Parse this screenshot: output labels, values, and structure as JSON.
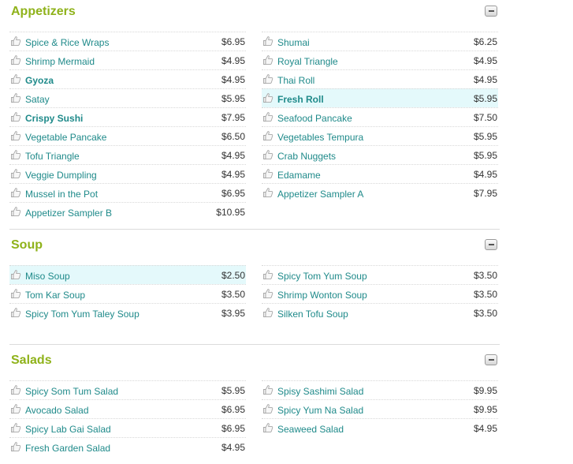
{
  "sections": [
    {
      "title": "Appetizers",
      "left": [
        {
          "name": "Spice & Rice Wraps",
          "price": "$6.95",
          "bold": false,
          "hl": false
        },
        {
          "name": "Shrimp Mermaid",
          "price": "$4.95",
          "bold": false,
          "hl": false
        },
        {
          "name": "Gyoza",
          "price": "$4.95",
          "bold": true,
          "hl": false
        },
        {
          "name": "Satay",
          "price": "$5.95",
          "bold": false,
          "hl": false
        },
        {
          "name": "Crispy Sushi",
          "price": "$7.95",
          "bold": true,
          "hl": false
        },
        {
          "name": "Vegetable Pancake",
          "price": "$6.50",
          "bold": false,
          "hl": false
        },
        {
          "name": "Tofu Triangle",
          "price": "$4.95",
          "bold": false,
          "hl": false
        },
        {
          "name": "Veggie Dumpling",
          "price": "$4.95",
          "bold": false,
          "hl": false
        },
        {
          "name": "Mussel in the Pot",
          "price": "$6.95",
          "bold": false,
          "hl": false
        },
        {
          "name": "Appetizer Sampler B",
          "price": "$10.95",
          "bold": false,
          "hl": false
        }
      ],
      "right": [
        {
          "name": "Shumai",
          "price": "$6.25",
          "bold": false,
          "hl": false
        },
        {
          "name": "Royal Triangle",
          "price": "$4.95",
          "bold": false,
          "hl": false
        },
        {
          "name": "Thai Roll",
          "price": "$4.95",
          "bold": false,
          "hl": false
        },
        {
          "name": "Fresh Roll",
          "price": "$5.95",
          "bold": true,
          "hl": true
        },
        {
          "name": "Seafood Pancake",
          "price": "$7.50",
          "bold": false,
          "hl": false
        },
        {
          "name": "Vegetables Tempura",
          "price": "$5.95",
          "bold": false,
          "hl": false
        },
        {
          "name": "Crab Nuggets",
          "price": "$5.95",
          "bold": false,
          "hl": false
        },
        {
          "name": "Edamame",
          "price": "$4.95",
          "bold": false,
          "hl": false
        },
        {
          "name": "Appetizer Sampler A",
          "price": "$7.95",
          "bold": false,
          "hl": false
        }
      ]
    },
    {
      "title": "Soup",
      "left": [
        {
          "name": "Miso Soup",
          "price": "$2.50",
          "bold": false,
          "hl": true
        },
        {
          "name": "Tom Kar Soup",
          "price": "$3.50",
          "bold": false,
          "hl": false
        },
        {
          "name": "Spicy Tom Yum Taley Soup",
          "price": "$3.95",
          "bold": false,
          "hl": false
        }
      ],
      "right": [
        {
          "name": "Spicy Tom Yum Soup",
          "price": "$3.50",
          "bold": false,
          "hl": false
        },
        {
          "name": "Shrimp Wonton Soup",
          "price": "$3.50",
          "bold": false,
          "hl": false
        },
        {
          "name": "Silken Tofu Soup",
          "price": "$3.50",
          "bold": false,
          "hl": false
        }
      ]
    },
    {
      "title": "Salads",
      "left": [
        {
          "name": "Spicy Som Tum Salad",
          "price": "$5.95",
          "bold": false,
          "hl": false
        },
        {
          "name": "Avocado Salad",
          "price": "$6.95",
          "bold": false,
          "hl": false
        },
        {
          "name": "Spicy Lab Gai Salad",
          "price": "$6.95",
          "bold": false,
          "hl": false
        },
        {
          "name": "Fresh Garden Salad",
          "price": "$4.95",
          "bold": false,
          "hl": false
        }
      ],
      "right": [
        {
          "name": "Spisy Sashimi Salad",
          "price": "$9.95",
          "bold": false,
          "hl": false
        },
        {
          "name": "Spicy Yum Na Salad",
          "price": "$9.95",
          "bold": false,
          "hl": false
        },
        {
          "name": "Seaweed Salad",
          "price": "$4.95",
          "bold": false,
          "hl": false
        }
      ]
    }
  ],
  "icons": {
    "item": "thumbs-up-icon",
    "collapse": "collapse-minus-icon"
  },
  "colors": {
    "title": "#8fb21a",
    "item_name": "#1f8a8a",
    "highlight": "#e4f9fb",
    "price": "#333333"
  }
}
